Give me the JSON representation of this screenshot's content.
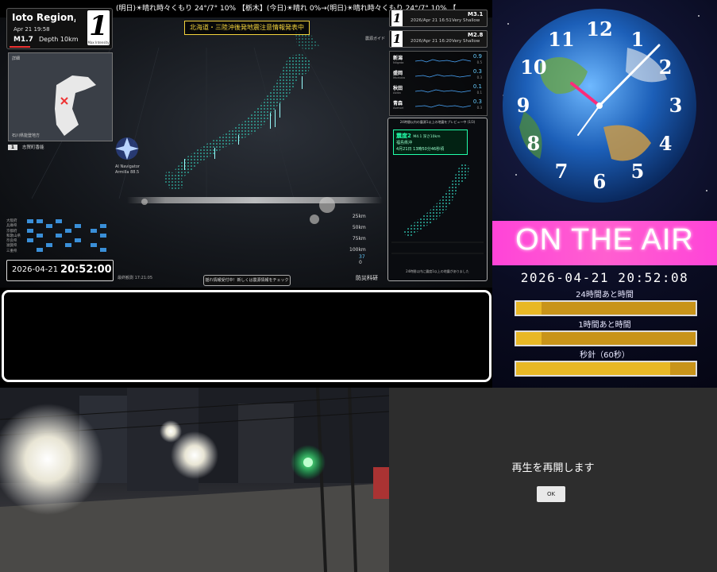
{
  "ticker": {
    "text": "(明日)☀晴れ時々くもり 24°/7° 10% 【栃木】(今日)☀晴れ 0%→(明日)☀晴れ時々くもり 24°/7° 10% 【"
  },
  "latest_quake": {
    "place": "Ioto Region, Ish",
    "datetime": "Apr 21 19:58",
    "magnitude": "M1.7",
    "depth": "Depth 10km",
    "intensity": "1",
    "intensity_caption": "Max Intensity",
    "minimap_label": "詳細",
    "minimap_footer": "石川県能登地方",
    "station_num": "1",
    "station_name": "志賀町香能"
  },
  "warning": "北海道・三陸沖後発地震注意情報発表中",
  "guide_label": "震源ガイド",
  "navigator": {
    "line1": "AI Navigator",
    "line2": "Armilla 88.5"
  },
  "depth_scale": [
    "25km",
    "50km",
    "75km",
    "100km"
  ],
  "scale_stats": {
    "count": "37",
    "zero": "0"
  },
  "history_labels": [
    "大阪府",
    "兵庫県",
    "京都府",
    "和歌山県",
    "奈良県",
    "滋賀県",
    "三重県"
  ],
  "datetime_box": {
    "date": "2026-04-21",
    "time": "20:52:00"
  },
  "updated": "最終観測 17:21:05",
  "check_button": "揺れ情報受付中！新しくは震源情報をチェック",
  "bosai": "防災科研",
  "feeds": [
    {
      "intensity": "1",
      "time": "2026/Apr 21 16:51",
      "magnitude": "M3.1",
      "depth": "Very Shallow"
    },
    {
      "intensity": "1",
      "time": "2026/Apr 21 16:20",
      "magnitude": "M2.8",
      "depth": "Very Shallow"
    }
  ],
  "stations": [
    {
      "name": "新潟",
      "roman": "Niigata",
      "value": "0.9",
      "scale": "0.5"
    },
    {
      "name": "盛岡",
      "roman": "Morioka",
      "value": "0.3",
      "scale": "0.3"
    },
    {
      "name": "秋田",
      "roman": "Akita",
      "value": "0.1",
      "scale": "0.1"
    },
    {
      "name": "青森",
      "roman": "Aomori",
      "value": "0.3",
      "scale": "0.3"
    }
  ],
  "preview": {
    "header": "24時間以内の震源1以上の地震をプレビュー中 (1/3)",
    "shindo": "震度2",
    "detail": "M4.1 深さ10km",
    "prefecture": "福島県沖",
    "time": "4月21日 13時50分46秒頃",
    "footer": "24時間以内に震度1以上の地震がありました"
  },
  "clock": {
    "numerals": [
      "12",
      "1",
      "2",
      "3",
      "4",
      "5",
      "6",
      "7",
      "8",
      "9",
      "10",
      "11"
    ],
    "onair": "ON THE AIR",
    "datetime": "2026-04-21 20:52:08",
    "bars": [
      {
        "label": "24時間あと時間",
        "fill": 0.14
      },
      {
        "label": "1時間あと時間",
        "fill": 0.14
      },
      {
        "label": "秒針（60秒）",
        "fill": 0.86
      }
    ]
  },
  "player": {
    "message": "再生を再開します",
    "ok_label": "OK"
  },
  "colors": {
    "onair_pink": "#ff44d8",
    "bar_gold": "#e8b826",
    "quake_cyan": "#2fd6c4",
    "warning_yellow": "#f2d23c"
  }
}
